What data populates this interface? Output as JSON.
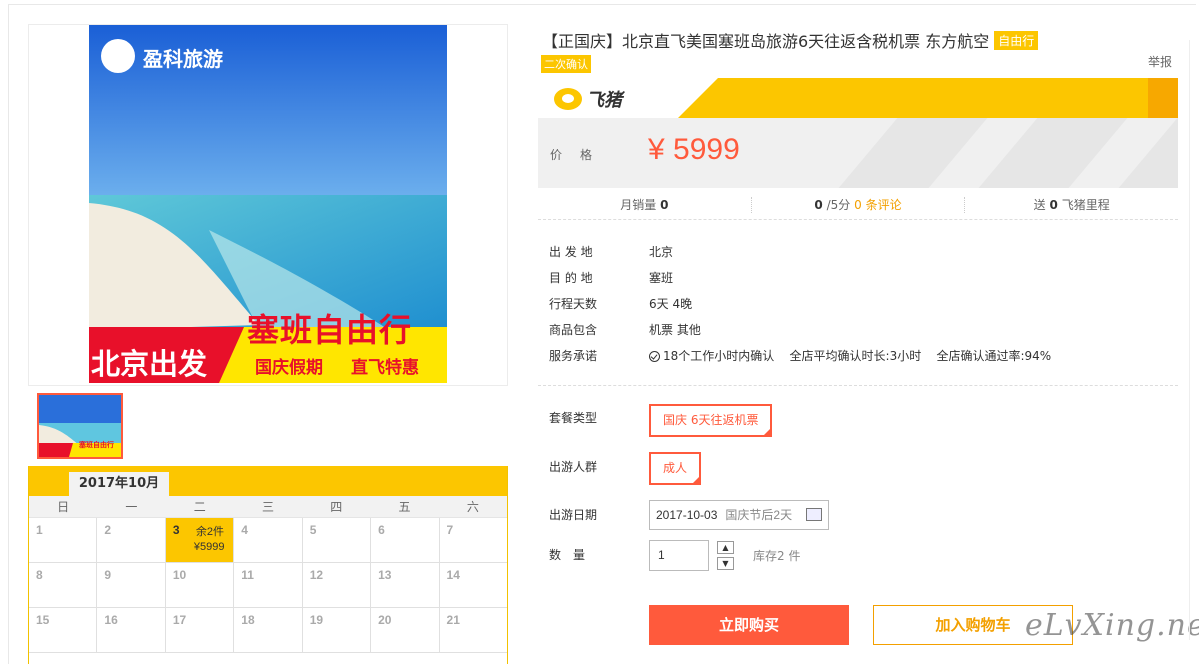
{
  "product": {
    "title": "【正国庆】北京直飞美国塞班岛旅游6天往返含税机票 东方航空",
    "tag_free": "自由行",
    "tag_confirm": "二次确认",
    "report": "举报"
  },
  "image": {
    "brand": "盈科旅游",
    "headline": "塞班自由行",
    "depart": "北京出发",
    "sub1": "国庆假期",
    "sub2": "直飞特惠",
    "thumb_headline": "塞班自由行"
  },
  "banner": {
    "logo_text": "飞猪"
  },
  "price": {
    "label": "价格",
    "value": "¥ 5999"
  },
  "stats": {
    "sales_label": "月销量",
    "sales_value": "0",
    "score_value": "0",
    "score_suffix": "/5分",
    "reviews": "0 条评论",
    "points_prefix": "送",
    "points_value": "0",
    "points_suffix": "飞猪里程"
  },
  "info": [
    {
      "k": "出 发 地",
      "v": "北京"
    },
    {
      "k": "目 的 地",
      "v": "塞班"
    },
    {
      "k": "行程天数",
      "v": "6天 4晚"
    },
    {
      "k": "商品包含",
      "v": "机票  其他"
    },
    {
      "k": "服务承诺",
      "v": "18个工作小时内确认    全店平均确认时长:3小时    全店确认通过率:94%"
    }
  ],
  "options": {
    "package_label": "套餐类型",
    "package_value": "国庆 6天往返机票",
    "people_label": "出游人群",
    "people_value": "成人",
    "date_label": "出游日期",
    "date_value": "2017-10-03",
    "date_note": "国庆节后2天",
    "qty_label": "数　量",
    "qty_value": "1",
    "stock": "库存2 件"
  },
  "buttons": {
    "buy": "立即购买",
    "cart": "加入购物车"
  },
  "calendar": {
    "month": "2017年10月",
    "weekdays": [
      "日",
      "一",
      "二",
      "三",
      "四",
      "五",
      "六"
    ],
    "rows": [
      [
        "1",
        "2",
        "3",
        "4",
        "5",
        "6",
        "7"
      ],
      [
        "8",
        "9",
        "10",
        "11",
        "12",
        "13",
        "14"
      ],
      [
        "15",
        "16",
        "17",
        "18",
        "19",
        "20",
        "21"
      ]
    ],
    "selected_stock": "余2件",
    "selected_price": "¥5999"
  },
  "watermark": "eLvXing.net",
  "colors": {
    "accent": "#ff5a3c",
    "brand_yellow": "#fcc600",
    "orange": "#f3a000"
  }
}
